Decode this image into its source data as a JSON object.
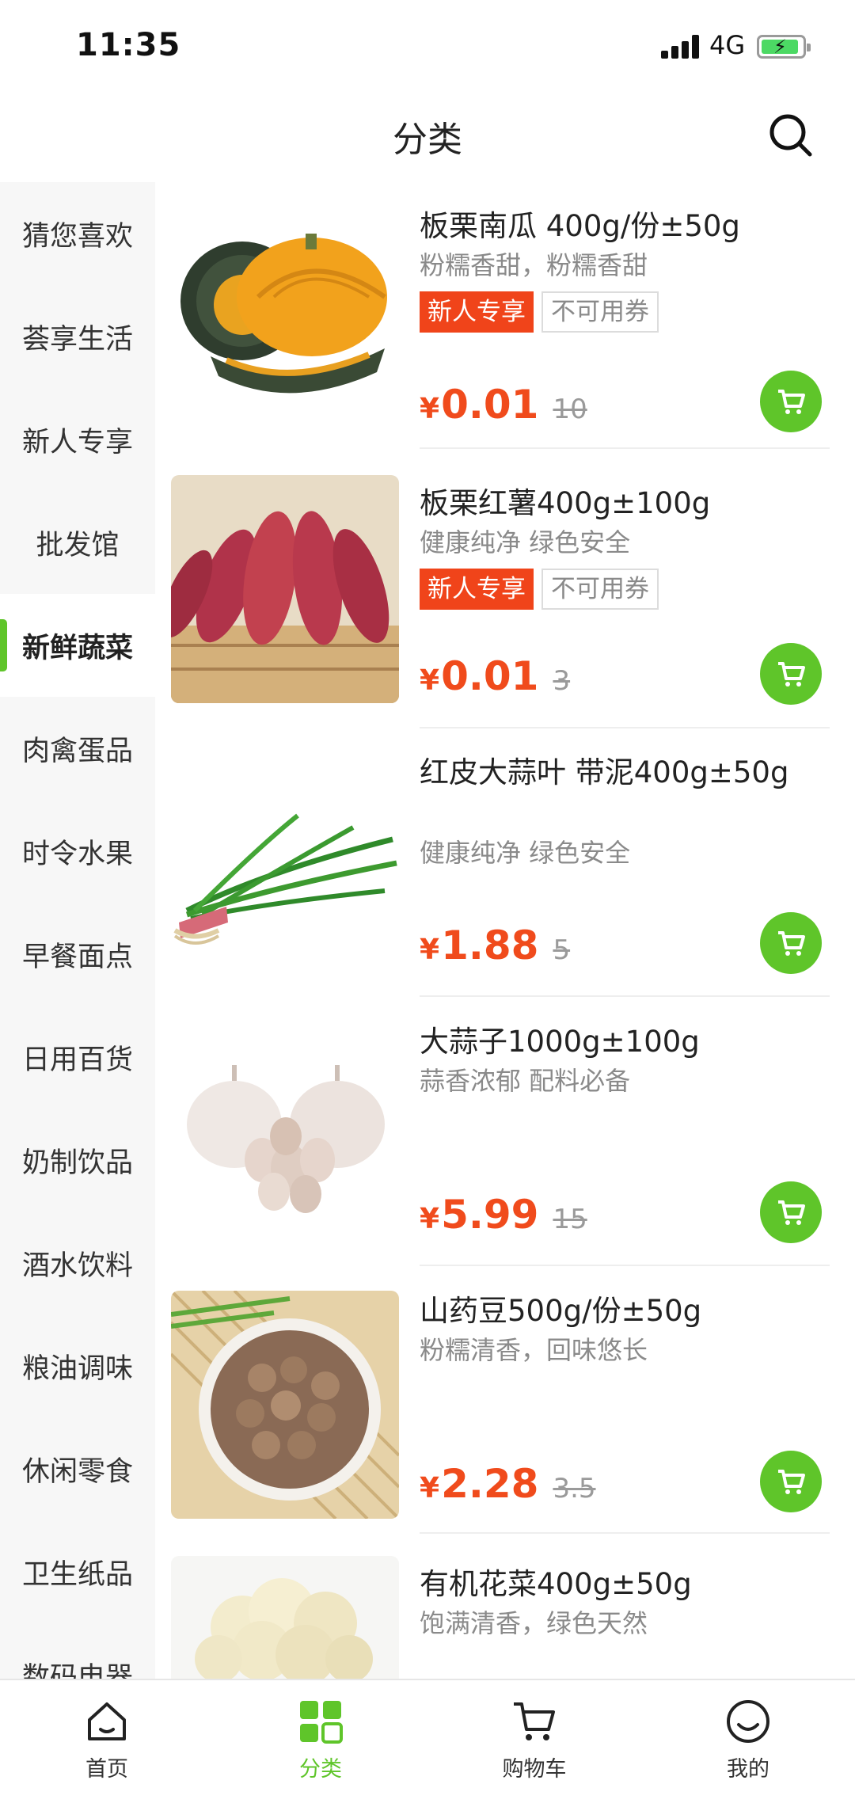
{
  "status_bar": {
    "time": "11:35",
    "network": "4G"
  },
  "header": {
    "title": "分类"
  },
  "sidebar": {
    "items": [
      {
        "label": "猜您喜欢"
      },
      {
        "label": "荟享生活"
      },
      {
        "label": "新人专享"
      },
      {
        "label": "批发馆"
      },
      {
        "label": "新鲜蔬菜",
        "active": true
      },
      {
        "label": "肉禽蛋品"
      },
      {
        "label": "时令水果"
      },
      {
        "label": "早餐面点"
      },
      {
        "label": "日用百货"
      },
      {
        "label": "奶制饮品"
      },
      {
        "label": "酒水饮料"
      },
      {
        "label": "粮油调味"
      },
      {
        "label": "休闲零食"
      },
      {
        "label": "卫生纸品"
      },
      {
        "label": "数码电器"
      }
    ]
  },
  "products": [
    {
      "name": "板栗南瓜 400g/份±50g",
      "desc": "粉糯香甜，粉糯香甜",
      "tags": [
        "新人专享",
        "不可用券"
      ],
      "price": "0.01",
      "original_price": "10",
      "image": "pumpkin"
    },
    {
      "name": "板栗红薯400g±100g",
      "desc": "健康纯净 绿色安全",
      "tags": [
        "新人专享",
        "不可用券"
      ],
      "price": "0.01",
      "original_price": "3",
      "image": "sweet-potato"
    },
    {
      "name": "红皮大蒜叶 带泥400g±50g",
      "desc": "健康纯净 绿色安全",
      "tags": [],
      "price": "1.88",
      "original_price": "5",
      "image": "garlic-leaf"
    },
    {
      "name": "大蒜子1000g±100g",
      "desc": "蒜香浓郁 配料必备",
      "tags": [],
      "price": "5.99",
      "original_price": "15",
      "image": "garlic"
    },
    {
      "name": "山药豆500g/份±50g",
      "desc": "粉糯清香，回味悠长",
      "tags": [],
      "price": "2.28",
      "original_price": "3.5",
      "image": "yam-bean"
    },
    {
      "name": "有机花菜400g±50g",
      "desc": "饱满清香，绿色天然",
      "tags": [],
      "price": "",
      "original_price": "",
      "image": "cauliflower"
    }
  ],
  "currency_symbol": "¥",
  "tab_bar": {
    "tabs": [
      {
        "label": "首页",
        "icon": "home-icon"
      },
      {
        "label": "分类",
        "icon": "category-icon",
        "active": true
      },
      {
        "label": "购物车",
        "icon": "cart-icon"
      },
      {
        "label": "我的",
        "icon": "profile-icon"
      }
    ]
  },
  "colors": {
    "accent": "#5fc52a",
    "price": "#f04b1c",
    "tag": "#f0441a"
  }
}
